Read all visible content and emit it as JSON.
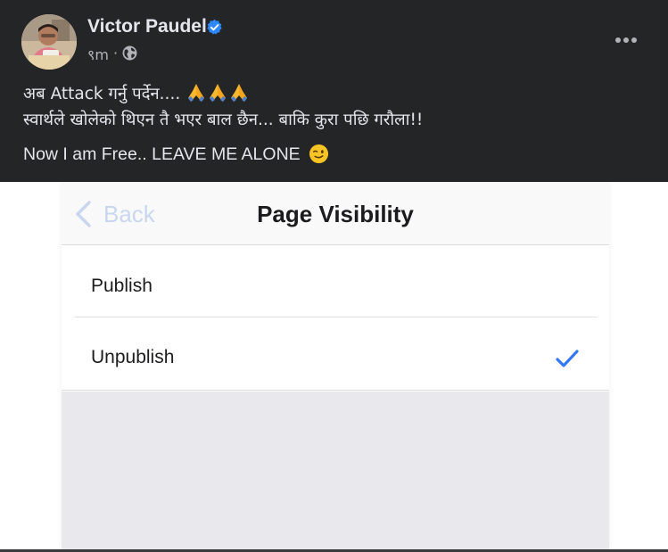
{
  "post": {
    "author": "Victor Paudel",
    "verified": true,
    "time": "९m",
    "separator": "·",
    "privacy_icon": "globe-icon",
    "more_icon": "more-horizontal-icon",
    "text": {
      "line1": "अब Attack गर्नु पर्देन.... ",
      "line2": "स्वार्थले खोलेको थिएन तै भएर बाल छैन... बाकि कुरा पछि गरौला!!",
      "line3": "Now I am Free.. LEAVE ME ALONE ",
      "emoji_line1": [
        "folded-hands-icon",
        "folded-hands-icon",
        "folded-hands-icon"
      ],
      "emoji_line3": "winking-face-icon"
    }
  },
  "attachment": {
    "back_label": "Back",
    "title": "Page Visibility",
    "options": [
      {
        "label": "Publish",
        "selected": false
      },
      {
        "label": "Unpublish",
        "selected": true
      }
    ]
  },
  "colors": {
    "background": "#242526",
    "text": "#e4e6eb",
    "secondary_text": "#b0b3b8",
    "verified_blue": "#2d88ff",
    "ios_blue": "#3478f6",
    "back_disabled": "#c9d7ee"
  }
}
